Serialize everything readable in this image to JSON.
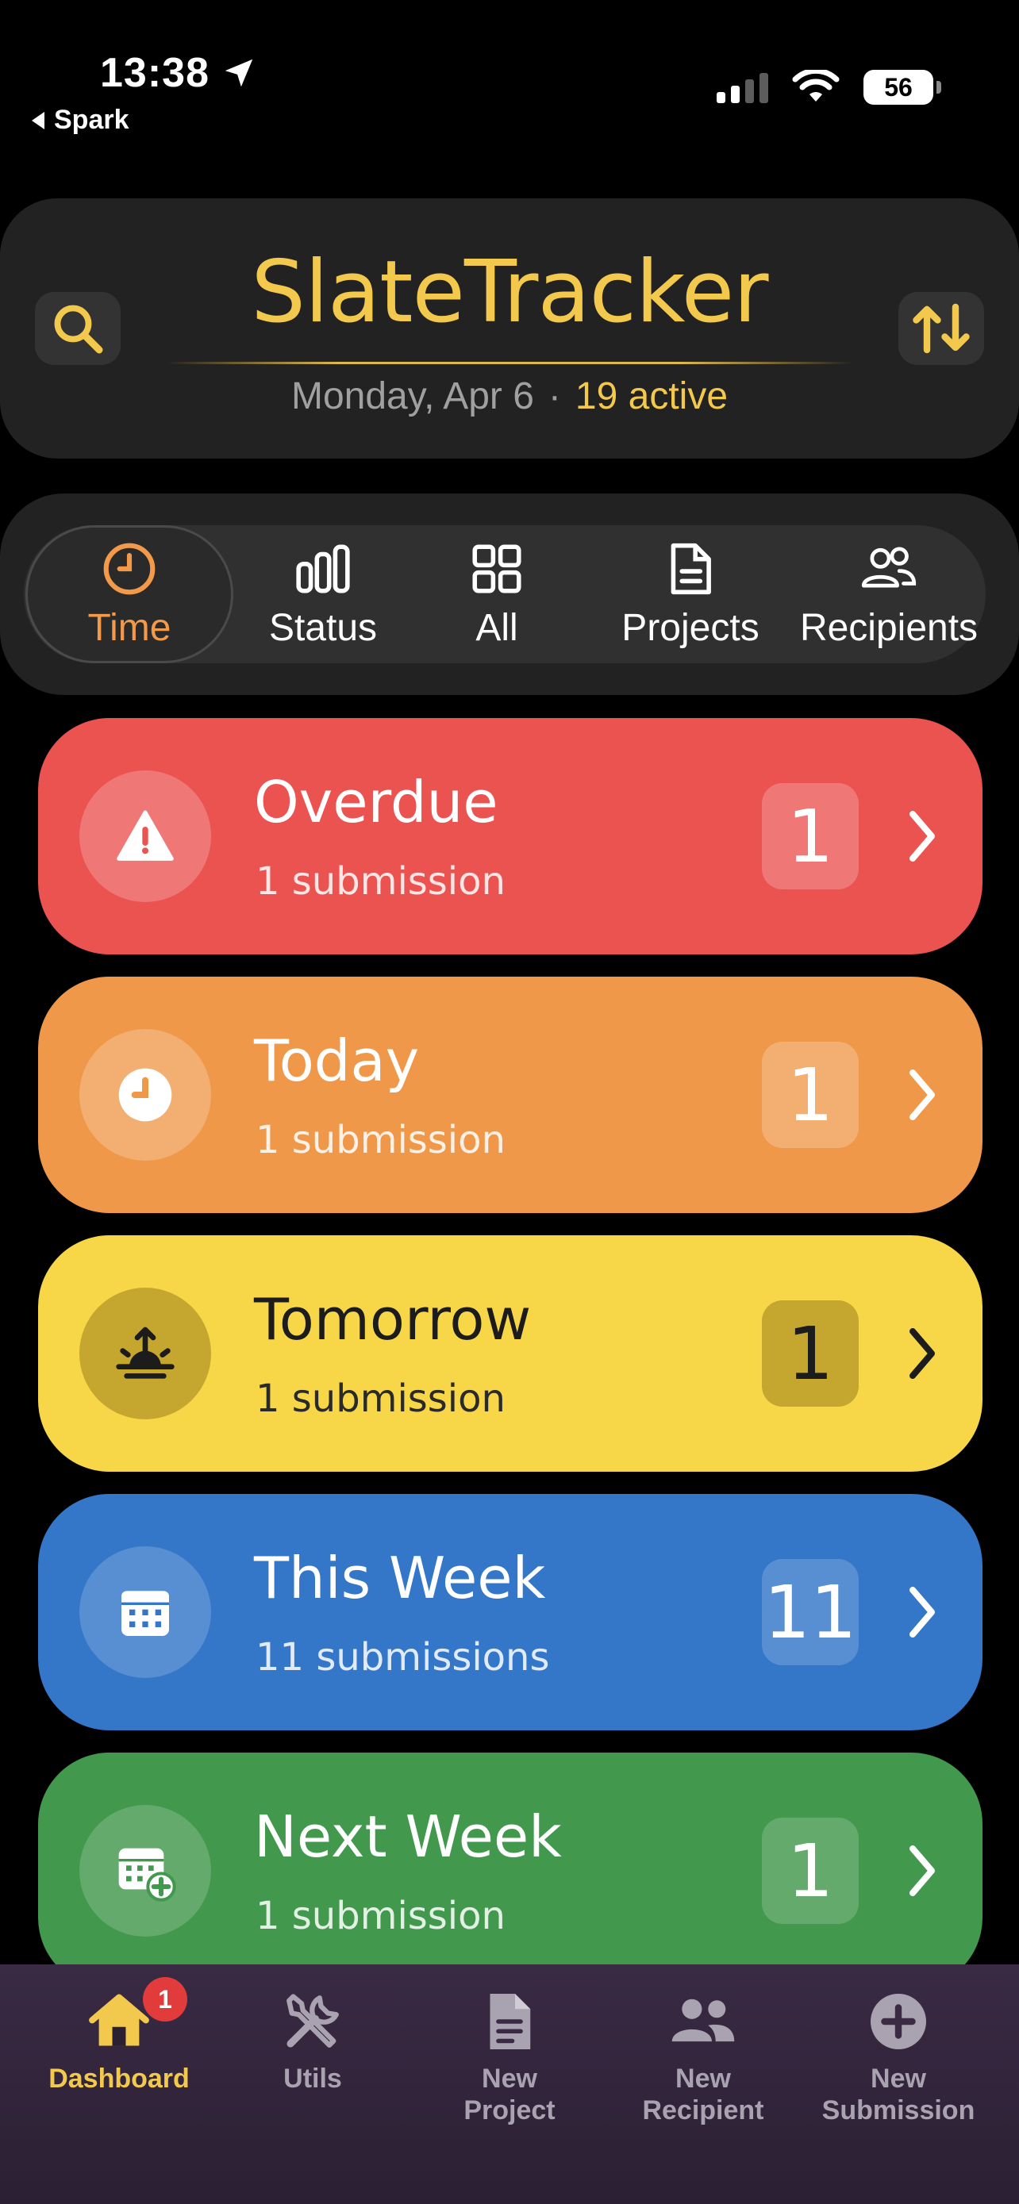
{
  "status_bar": {
    "time": "13:38",
    "back_app": "Spark",
    "battery": "56"
  },
  "header": {
    "title": "SlateTracker",
    "date": "Monday, Apr 6",
    "separator": "·",
    "active_count": "19 active"
  },
  "filters": [
    {
      "label": "Time",
      "icon": "clock-icon",
      "selected": true
    },
    {
      "label": "Status",
      "icon": "bar-chart-icon",
      "selected": false
    },
    {
      "label": "All",
      "icon": "grid-icon",
      "selected": false
    },
    {
      "label": "Projects",
      "icon": "document-icon",
      "selected": false
    },
    {
      "label": "Recipients",
      "icon": "people-icon",
      "selected": false
    }
  ],
  "categories": [
    {
      "title": "Overdue",
      "subtitle": "1 submission",
      "count": "1",
      "icon": "warning-icon",
      "color": "#eb5350"
    },
    {
      "title": "Today",
      "subtitle": "1 submission",
      "count": "1",
      "icon": "clock-icon",
      "color": "#f0984a"
    },
    {
      "title": "Tomorrow",
      "subtitle": "1 submission",
      "count": "1",
      "icon": "sunrise-icon",
      "color": "#f7d748"
    },
    {
      "title": "This Week",
      "subtitle": "11 submissions",
      "count": "11",
      "icon": "calendar-icon",
      "color": "#3477c9"
    },
    {
      "title": "Next Week",
      "subtitle": "1 submission",
      "count": "1",
      "icon": "calendar-plus-icon",
      "color": "#42984d"
    }
  ],
  "tab_bar": {
    "dashboard": {
      "label": "Dashboard",
      "badge": "1"
    },
    "utils": {
      "label": "Utils"
    },
    "new_project": {
      "line1": "New",
      "line2": "Project"
    },
    "new_recipient": {
      "line1": "New",
      "line2": "Recipient"
    },
    "new_submission": {
      "line1": "New",
      "line2": "Submission"
    }
  },
  "colors": {
    "accent_gold": "#f2c94c",
    "accent_orange": "#f2994a",
    "background": "#000000"
  }
}
